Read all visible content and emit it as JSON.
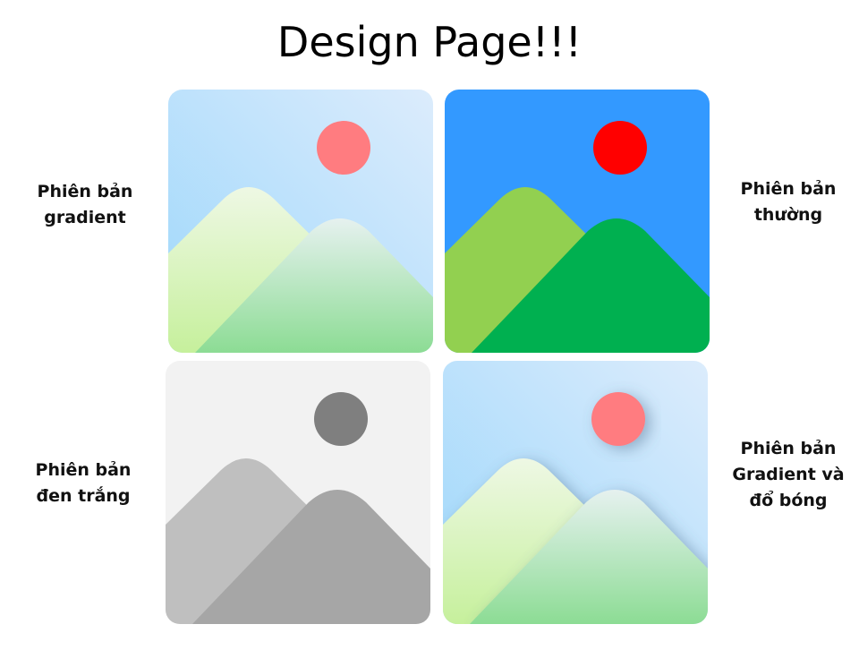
{
  "page": {
    "title": "Design Page!!!"
  },
  "variants": [
    {
      "id": "gradient",
      "label_lines": [
        "Phiên bản",
        "gradient"
      ]
    },
    {
      "id": "normal",
      "label_lines": [
        "Phiên bản",
        "thường"
      ]
    },
    {
      "id": "grayscale",
      "label_lines": [
        "Phiên bản",
        "đen trắng"
      ]
    },
    {
      "id": "gradient-shadow",
      "label_lines": [
        "Phiên bản",
        "Gradient và",
        "đổ bóng"
      ]
    }
  ],
  "colors": {
    "normal_sky": "#3399ff",
    "normal_sun": "#ff0000",
    "normal_left_mountain": "#92d050",
    "normal_right_mountain": "#00b050",
    "gradient_sun": "#ff7c80",
    "grayscale_bg": "#f2f2f2",
    "grayscale_sun": "#7f7f7f",
    "grayscale_left_mountain": "#bfbfbf",
    "grayscale_right_mountain": "#a6a6a6"
  },
  "icons": [
    "image-icon-gradient",
    "image-icon-normal",
    "image-icon-grayscale",
    "image-icon-gradient-shadow"
  ]
}
